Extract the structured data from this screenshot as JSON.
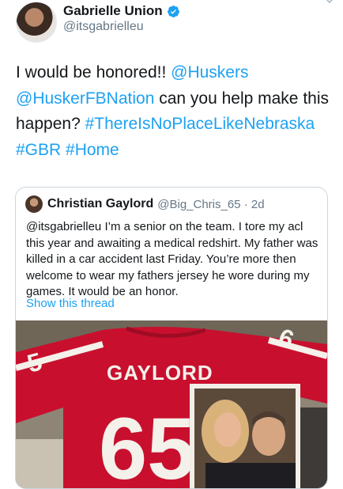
{
  "author": {
    "display_name": "Gabrielle Union",
    "handle": "@itsgabrielleu"
  },
  "tweet": {
    "text_1": "I would be honored!! ",
    "mention_1": "@Huskers",
    "mention_2": "@HuskerFBNation",
    "text_2": " can you help make this happen? ",
    "hashtag_1": "#ThereIsNoPlaceLikeNebraska",
    "hashtag_2": "#GBR",
    "hashtag_3": "#Home"
  },
  "quoted": {
    "display_name": "Christian Gaylord",
    "handle": "@Big_Chris_65",
    "separator": " · ",
    "time": "2d",
    "text": "@itsgabrielleu I’m a senior on the team. I tore my acl this year and awaiting a medical redshirt. My father was killed in a car accident last Friday. You’re more then welcome to wear my fathers jersey he wore during my games. It would be an honor.",
    "show_thread": "Show this thread",
    "image": {
      "jersey_name": "GAYLORD",
      "jersey_number": "65",
      "sleeve_number_left": "5",
      "sleeve_number_right": "6"
    }
  },
  "colors": {
    "link": "#1da1f2",
    "text": "#14171a",
    "secondary": "#657786",
    "border": "#ccd6dd",
    "jersey_red": "#c8102e"
  },
  "icons": {
    "verified": "verified-badge-icon",
    "caret": "chevron-down-icon"
  }
}
